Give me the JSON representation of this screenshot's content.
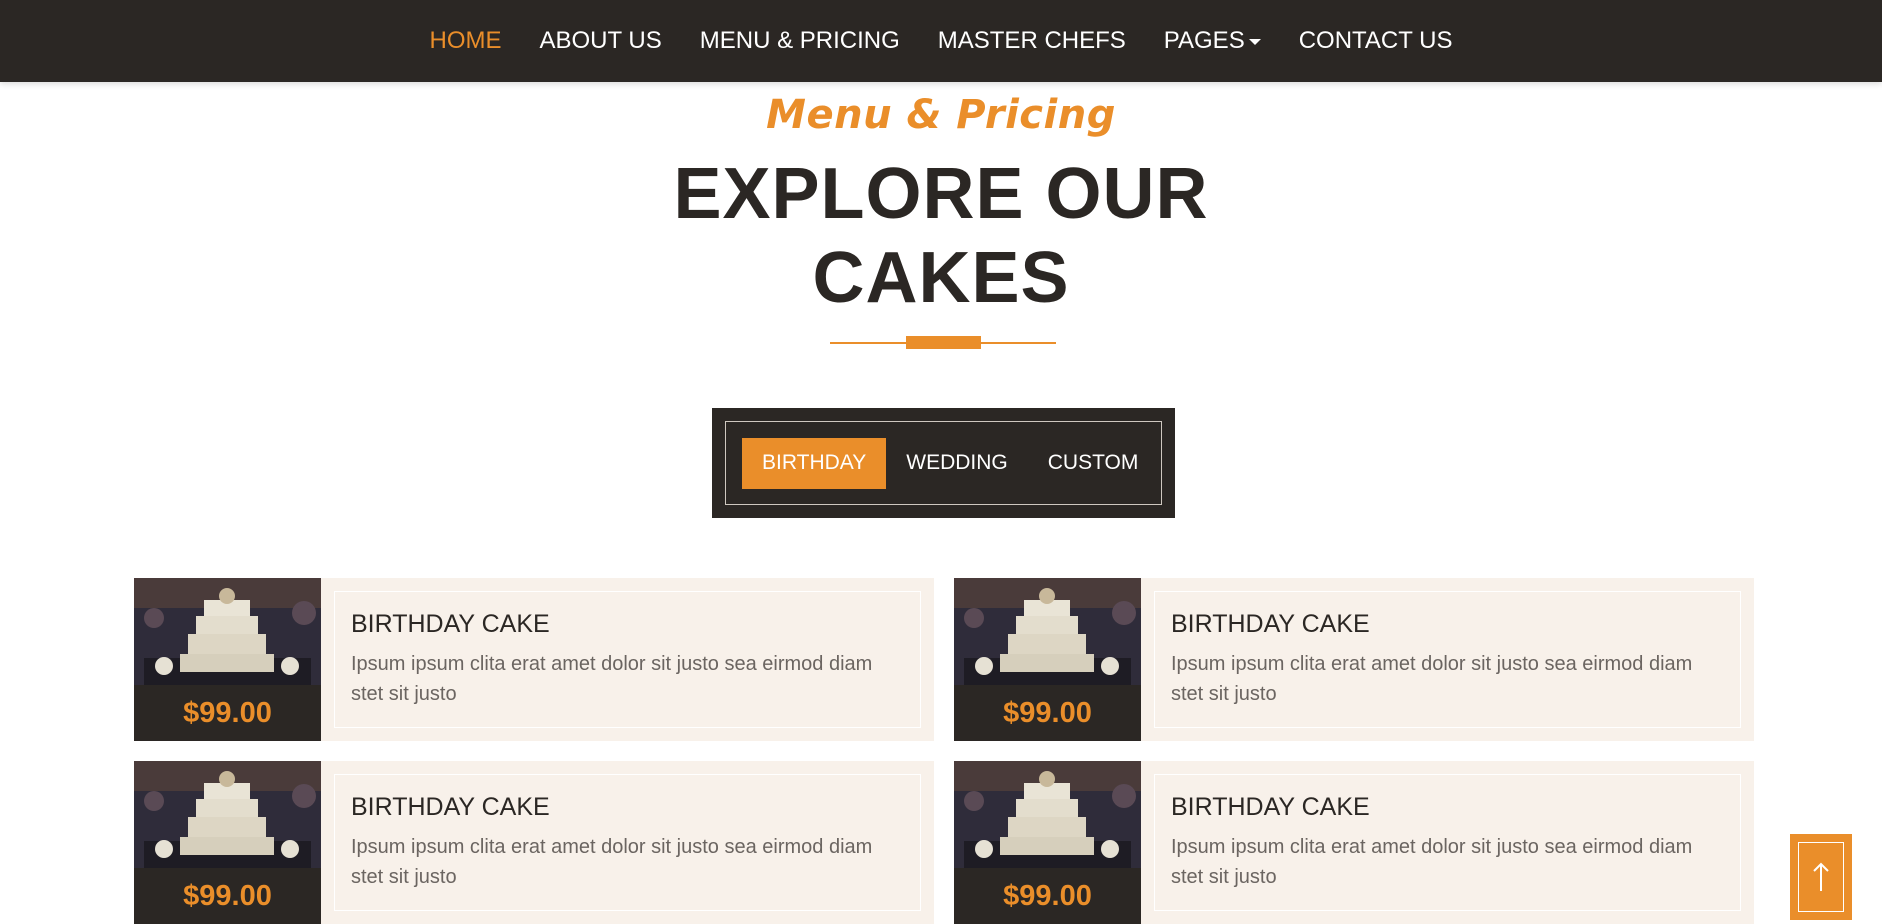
{
  "nav": {
    "items": [
      {
        "label": "HOME",
        "active": true
      },
      {
        "label": "ABOUT US"
      },
      {
        "label": "MENU & PRICING"
      },
      {
        "label": "MASTER CHEFS"
      },
      {
        "label": "PAGES",
        "dropdown": true
      },
      {
        "label": "CONTACT US"
      }
    ]
  },
  "header": {
    "subtitle": "Menu & Pricing",
    "title_line1": "EXPLORE OUR",
    "title_line2": "CAKES"
  },
  "tabs": [
    {
      "label": "BIRTHDAY",
      "active": true
    },
    {
      "label": "WEDDING"
    },
    {
      "label": "CUSTOM"
    }
  ],
  "cards": [
    {
      "name": "BIRTHDAY CAKE",
      "desc": "Ipsum ipsum clita erat amet dolor sit justo sea eirmod diam stet sit justo",
      "price": "$99.00"
    },
    {
      "name": "BIRTHDAY CAKE",
      "desc": "Ipsum ipsum clita erat amet dolor sit justo sea eirmod diam stet sit justo",
      "price": "$99.00"
    },
    {
      "name": "BIRTHDAY CAKE",
      "desc": "Ipsum ipsum clita erat amet dolor sit justo sea eirmod diam stet sit justo",
      "price": "$99.00"
    },
    {
      "name": "BIRTHDAY CAKE",
      "desc": "Ipsum ipsum clita erat amet dolor sit justo sea eirmod diam stet sit justo",
      "price": "$99.00"
    }
  ],
  "colors": {
    "accent": "#ea8e2a",
    "dark": "#2b2724",
    "card_bg": "#f8f1ea"
  },
  "icons": {
    "back_to_top": "arrow-up-icon",
    "dropdown": "caret-down-icon"
  }
}
